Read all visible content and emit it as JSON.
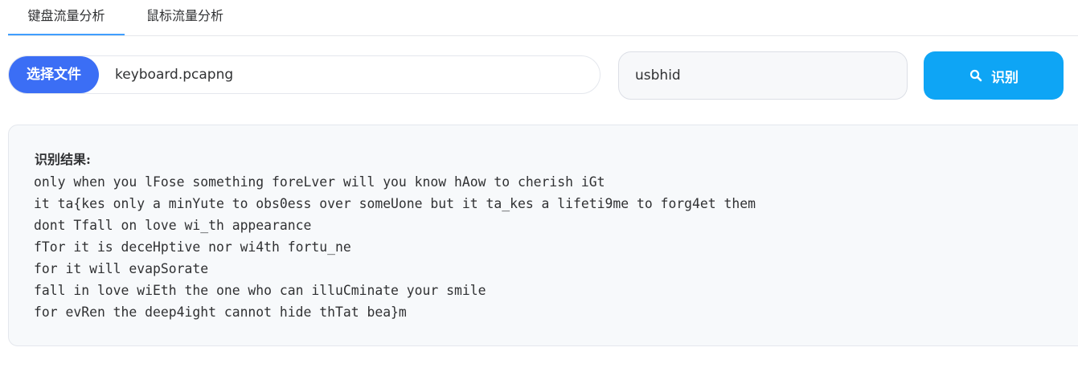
{
  "tabs": [
    {
      "label": "键盘流量分析",
      "active": true
    },
    {
      "label": "鼠标流量分析",
      "active": false
    }
  ],
  "file": {
    "choose_label": "选择文件",
    "file_name": "keyboard.pcapng"
  },
  "filter": {
    "value": "usbhid"
  },
  "recognize": {
    "label": "识别",
    "icon": "search-icon"
  },
  "result": {
    "title": "识别结果:",
    "lines": [
      "only when you lFose something foreLver will you know hAow to cherish iGt",
      "it ta{kes only a minYute to obs0ess over someUone but it ta_kes a lifeti9me to forg4et them",
      "dont Tfall on love wi_th appearance",
      "fTor it is deceHptive nor wi4th fortu_ne",
      "for it will evapSorate",
      "fall in love wiEth the one who can illuCminate your smile",
      "for evRen the deep4ight cannot hide thTat bea}m"
    ]
  },
  "colors": {
    "tab_active_underline": "#409eff",
    "choose_button": "#3b6ef5",
    "recognize_button": "#0ea5f5"
  }
}
